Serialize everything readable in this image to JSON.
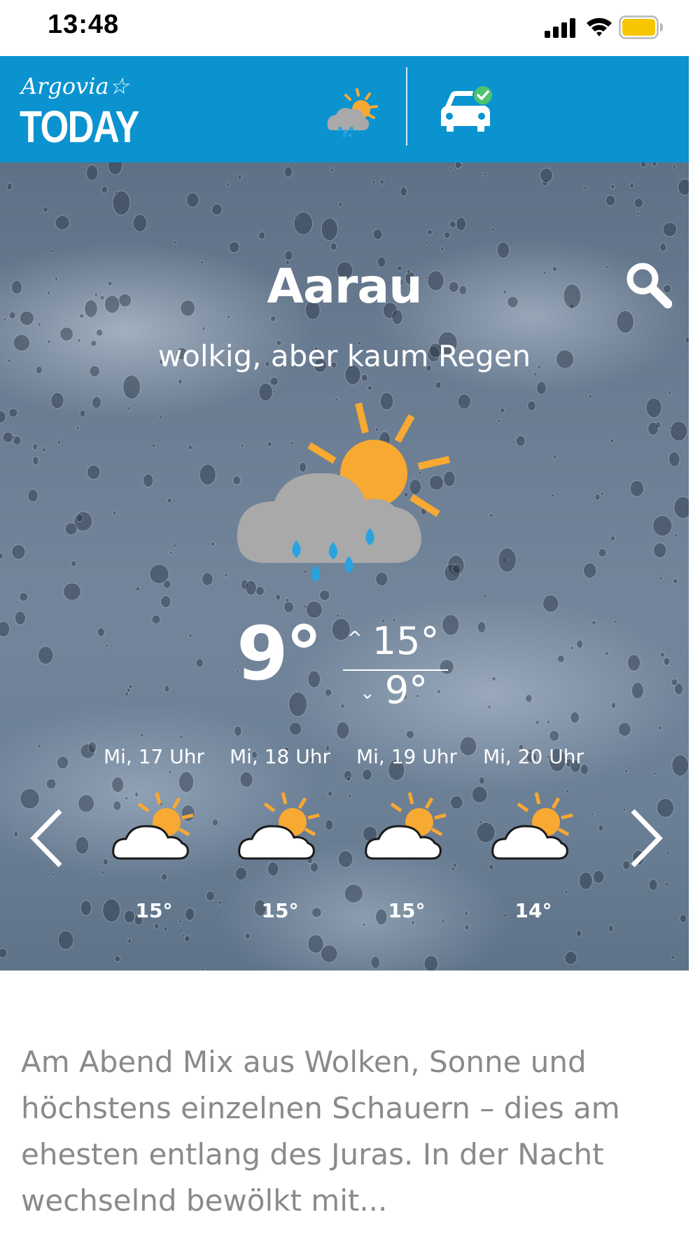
{
  "status_bar": {
    "time": "13:48",
    "icons": [
      "signal-icon",
      "wifi-icon",
      "battery-icon"
    ],
    "battery_color": "#f7c600"
  },
  "header": {
    "logo_script": "Argovia☆",
    "logo_main": "TODAY",
    "background_color": "#0a93cf",
    "nav_icons": [
      "weather-icon",
      "traffic-car-icon"
    ],
    "car_badge_color": "#4cc46e"
  },
  "weather": {
    "city": "Aarau",
    "condition": "wolkig, aber kaum Regen",
    "current_temp": "9°",
    "max_temp": "15°",
    "min_temp": "9°",
    "max_arrow": "^",
    "min_arrow": "⌄",
    "main_icon": "sun-cloud-rain-icon",
    "sun_color": "#f8a932",
    "drop_color": "#29a3e0",
    "hourly": [
      {
        "label": "Mi, 17 Uhr",
        "temp": "15°",
        "icon": "sun-cloud-icon"
      },
      {
        "label": "Mi, 18 Uhr",
        "temp": "15°",
        "icon": "sun-cloud-icon"
      },
      {
        "label": "Mi, 19 Uhr",
        "temp": "15°",
        "icon": "sun-cloud-icon"
      },
      {
        "label": "Mi, 20 Uhr",
        "temp": "14°",
        "icon": "sun-cloud-icon"
      }
    ]
  },
  "summary": {
    "text": "Am Abend Mix aus Wolken, Sonne und höchstens einzelnen Schauern – dies am ehesten entlang des Juras. In der Nacht wechselnd bewölkt mit..."
  }
}
